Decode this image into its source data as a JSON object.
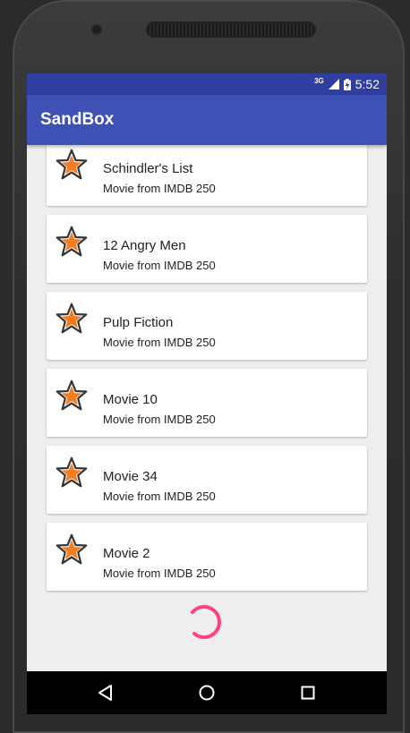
{
  "status": {
    "network": "3G",
    "time": "5:52"
  },
  "app": {
    "title": "SandBox"
  },
  "items": [
    {
      "title": "Schindler's List",
      "subtitle": "Movie from IMDB 250"
    },
    {
      "title": "12 Angry Men",
      "subtitle": "Movie from IMDB 250"
    },
    {
      "title": "Pulp Fiction",
      "subtitle": "Movie from IMDB 250"
    },
    {
      "title": "Movie 10",
      "subtitle": "Movie from IMDB 250"
    },
    {
      "title": "Movie 34",
      "subtitle": "Movie from IMDB 250"
    },
    {
      "title": "Movie 2",
      "subtitle": "Movie from IMDB 250"
    }
  ],
  "icons": {
    "item": "star-icon",
    "loading": "spinner-icon",
    "nav": [
      "back-icon",
      "home-icon",
      "recents-icon"
    ]
  },
  "colors": {
    "status_bar": "#303f9f",
    "app_bar": "#3f51b5",
    "star": "#f57c1f",
    "spinner": "#ff4081"
  }
}
